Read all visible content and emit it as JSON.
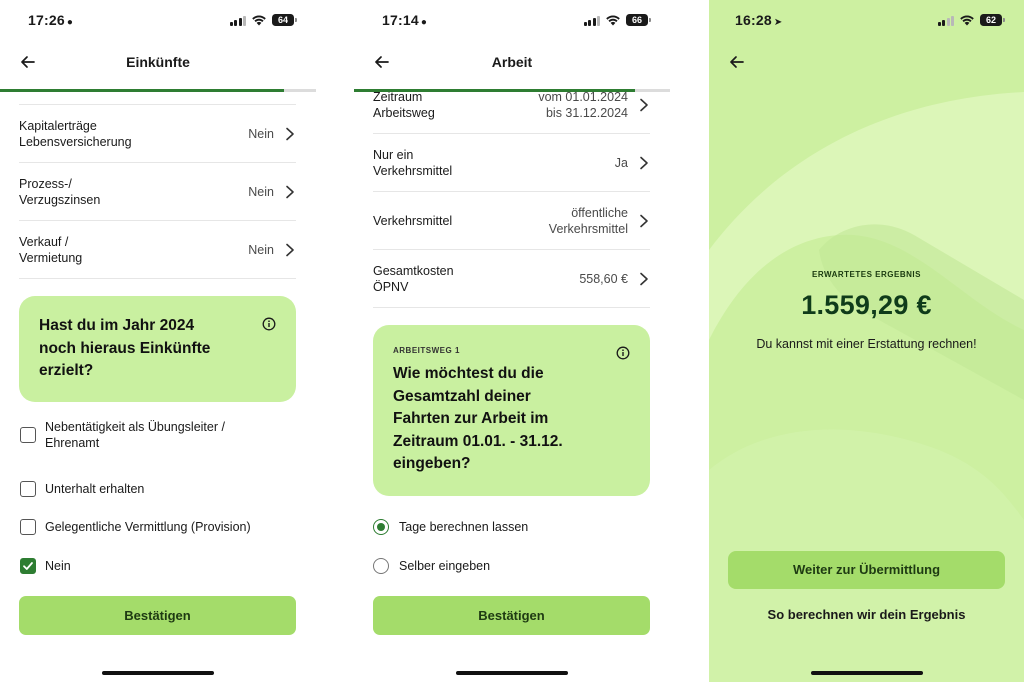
{
  "screen1": {
    "status": {
      "time": "17:26",
      "battery": "64"
    },
    "title": "Einkünfte",
    "progress": 0.9,
    "rows": [
      {
        "label": "Kapitalerträge\nLebensversicherung",
        "value": "Nein"
      },
      {
        "label": "Prozess-/\nVerzugszinsen",
        "value": "Nein"
      },
      {
        "label": "Verkauf /\nVermietung",
        "value": "Nein"
      }
    ],
    "question": "Hast du im Jahr 2024\nnoch hieraus Einkünfte\nerzielt?",
    "options": [
      {
        "label": "Nebentätigkeit als Übungsleiter /\nEhrenamt",
        "checked": false
      },
      {
        "label": "Unterhalt erhalten",
        "checked": false
      },
      {
        "label": "Gelegentliche Vermittlung (Provision)",
        "checked": false
      },
      {
        "label": "Nein",
        "checked": true
      }
    ],
    "confirm": "Bestätigen"
  },
  "screen2": {
    "status": {
      "time": "17:14",
      "battery": "66"
    },
    "title": "Arbeit",
    "progress": 0.89,
    "rows": [
      {
        "label": "Zeitraum\nArbeitsweg",
        "value": "vom 01.01.2024\nbis 31.12.2024"
      },
      {
        "label": "Nur ein\nVerkehrsmittel",
        "value": "Ja"
      },
      {
        "label": "Verkehrsmittel",
        "value": "öffentliche\nVerkehrsmittel"
      },
      {
        "label": "Gesamtkosten\nÖPNV",
        "value": "558,60 €"
      }
    ],
    "kicker": "ARBEITSWEG 1",
    "question": "Wie möchtest du die\nGesamtzahl deiner\nFahrten zur Arbeit im\nZeitraum 01.01. - 31.12.\neingeben?",
    "options": [
      {
        "label": "Tage berechnen lassen",
        "selected": true
      },
      {
        "label": "Selber eingeben",
        "selected": false
      }
    ],
    "confirm": "Bestätigen"
  },
  "screen3": {
    "status": {
      "time": "16:28",
      "battery": "62"
    },
    "kicker": "ERWARTETES ERGEBNIS",
    "amount": "1.559,29 €",
    "subtitle": "Du kannst mit einer Erstattung rechnen!",
    "primary_button": "Weiter zur Übermittlung",
    "link": "So berechnen wir dein Ergebnis"
  },
  "colors": {
    "accent": "#2e7d32",
    "card": "#c9f0a0",
    "button": "#a4dc6a",
    "result_bg": "#cdf0a1"
  }
}
